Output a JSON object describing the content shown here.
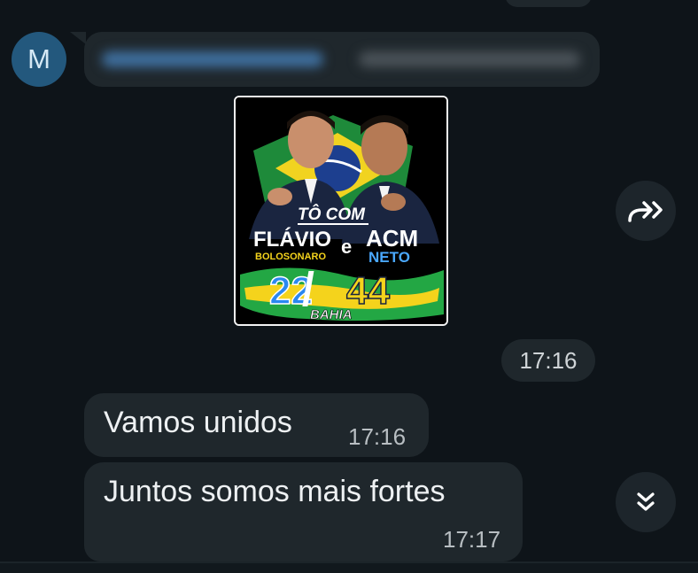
{
  "chat": {
    "avatar_letter": "M",
    "messages": [
      {
        "type": "sticker",
        "time": "17:16",
        "sticker_text": {
          "line1": "TÔ COM",
          "name1": "FLÁVIO",
          "surname1": "BOLOSONARO",
          "connector": "e",
          "name2": "ACM",
          "surname2": "NETO",
          "number1": "22",
          "number2": "44",
          "region": "BAHIA"
        }
      },
      {
        "type": "text",
        "text": "Vamos unidos",
        "time": "17:16"
      },
      {
        "type": "text",
        "text": "Juntos somos mais fortes",
        "time": "17:17"
      }
    ]
  },
  "icons": {
    "forward": "forward-icon",
    "scroll_down": "double-chevron-down-icon"
  },
  "colors": {
    "background": "#0e1419",
    "bubble": "#1f272c",
    "avatar": "#23587d"
  }
}
